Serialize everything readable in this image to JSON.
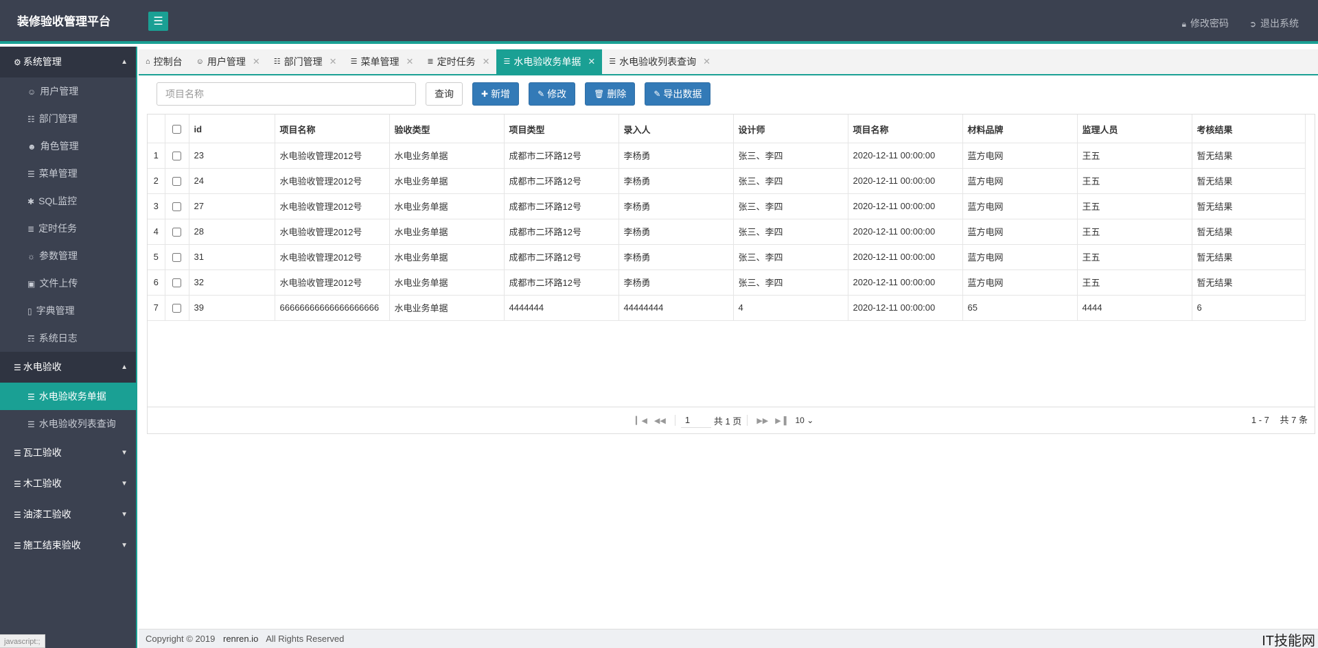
{
  "header": {
    "logo": "装修验收管理平台",
    "toggle_icon": "bars-icon",
    "change_password": "修改密码",
    "logout": "退出系统"
  },
  "sidebar": {
    "groups": [
      {
        "label": "系统管理",
        "icon": "gear-icon",
        "expanded": true,
        "items": [
          {
            "label": "用户管理",
            "icon": "user-icon"
          },
          {
            "label": "部门管理",
            "icon": "file-icon"
          },
          {
            "label": "角色管理",
            "icon": "user-secret-icon"
          },
          {
            "label": "菜单管理",
            "icon": "list-icon"
          },
          {
            "label": "SQL监控",
            "icon": "bug-icon"
          },
          {
            "label": "定时任务",
            "icon": "tasks-icon"
          },
          {
            "label": "参数管理",
            "icon": "sun-icon"
          },
          {
            "label": "文件上传",
            "icon": "image-icon"
          },
          {
            "label": "字典管理",
            "icon": "bookmark-icon"
          },
          {
            "label": "系统日志",
            "icon": "file-text-icon"
          }
        ]
      },
      {
        "label": "水电验收",
        "icon": "list-icon",
        "expanded": true,
        "items": [
          {
            "label": "水电验收务单据",
            "icon": "list-icon",
            "active": true
          },
          {
            "label": "水电验收列表查询",
            "icon": "list-icon"
          }
        ]
      },
      {
        "label": "瓦工验收",
        "icon": "list-icon",
        "expanded": false,
        "items": []
      },
      {
        "label": "木工验收",
        "icon": "list-icon",
        "expanded": false,
        "items": []
      },
      {
        "label": "油漆工验收",
        "icon": "list-icon",
        "expanded": false,
        "items": []
      },
      {
        "label": "施工结束验收",
        "icon": "list-icon",
        "expanded": false,
        "items": []
      }
    ]
  },
  "tabs": [
    {
      "label": "控制台",
      "icon": "home-icon",
      "closable": false
    },
    {
      "label": "用户管理",
      "icon": "user-icon",
      "closable": true
    },
    {
      "label": "部门管理",
      "icon": "file-icon",
      "closable": true
    },
    {
      "label": "菜单管理",
      "icon": "list-icon",
      "closable": true
    },
    {
      "label": "定时任务",
      "icon": "tasks-icon",
      "closable": true
    },
    {
      "label": "水电验收务单据",
      "icon": "list-icon",
      "closable": true,
      "active": true
    },
    {
      "label": "水电验收列表查询",
      "icon": "list-icon",
      "closable": true
    }
  ],
  "toolbar": {
    "search_placeholder": "项目名称",
    "query": "查询",
    "add": "新增",
    "edit": "修改",
    "delete": "删除",
    "export": "导出数据"
  },
  "table": {
    "columns": [
      "id",
      "项目名称",
      "验收类型",
      "项目类型",
      "录入人",
      "设计师",
      "项目名称",
      "材料品牌",
      "监理人员",
      "考核结果"
    ],
    "rows": [
      [
        "1",
        "23",
        "水电验收管理2012号",
        "水电业务单据",
        "成都市二环路12号",
        "李杨勇",
        "张三、李四",
        "2020-12-11 00:00:00",
        "蓝方电网",
        "王五",
        "暂无结果"
      ],
      [
        "2",
        "24",
        "水电验收管理2012号",
        "水电业务单据",
        "成都市二环路12号",
        "李杨勇",
        "张三、李四",
        "2020-12-11 00:00:00",
        "蓝方电网",
        "王五",
        "暂无结果"
      ],
      [
        "3",
        "27",
        "水电验收管理2012号",
        "水电业务单据",
        "成都市二环路12号",
        "李杨勇",
        "张三、李四",
        "2020-12-11 00:00:00",
        "蓝方电网",
        "王五",
        "暂无结果"
      ],
      [
        "4",
        "28",
        "水电验收管理2012号",
        "水电业务单据",
        "成都市二环路12号",
        "李杨勇",
        "张三、李四",
        "2020-12-11 00:00:00",
        "蓝方电网",
        "王五",
        "暂无结果"
      ],
      [
        "5",
        "31",
        "水电验收管理2012号",
        "水电业务单据",
        "成都市二环路12号",
        "李杨勇",
        "张三、李四",
        "2020-12-11 00:00:00",
        "蓝方电网",
        "王五",
        "暂无结果"
      ],
      [
        "6",
        "32",
        "水电验收管理2012号",
        "水电业务单据",
        "成都市二环路12号",
        "李杨勇",
        "张三、李四",
        "2020-12-11 00:00:00",
        "蓝方电网",
        "王五",
        "暂无结果"
      ],
      [
        "7",
        "39",
        "66666666666666666666",
        "水电业务单据",
        "4444444",
        "44444444",
        "4",
        "2020-12-11 00:00:00",
        "65",
        "4444",
        "6"
      ]
    ]
  },
  "pager": {
    "page_value": "1",
    "total_pages": "共 1 页",
    "page_size": "10",
    "range": "1 - 7",
    "total_records": "共 7 条"
  },
  "footer": {
    "copyright": "Copyright © 2019",
    "site": "renren.io",
    "rights": "All Rights Reserved"
  },
  "status_bar": "javascript:;",
  "watermark": "IT技能网",
  "colors": {
    "accent": "#1aa094",
    "dark": "#3b4150",
    "primary": "#337ab7"
  }
}
